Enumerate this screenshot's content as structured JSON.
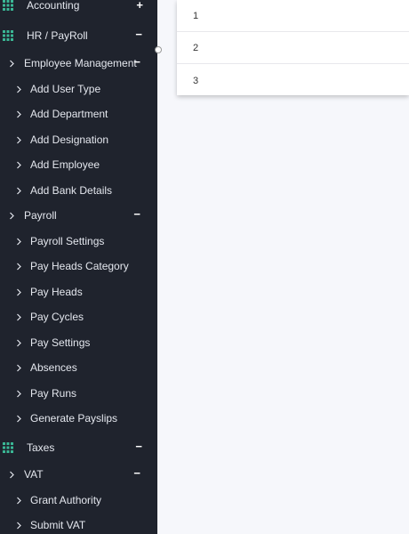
{
  "sidebar": {
    "sections": [
      {
        "label": "Accounting",
        "toggle": "+"
      },
      {
        "label": "HR / PayRoll",
        "toggle": "−"
      },
      {
        "label": "Taxes",
        "toggle": "−"
      }
    ],
    "submenus": [
      {
        "label": "Employee Management",
        "toggle": "−"
      },
      {
        "label": "Payroll",
        "toggle": "−"
      },
      {
        "label": "VAT",
        "toggle": "−"
      }
    ],
    "employee_items": [
      "Add User Type",
      "Add Department",
      "Add Designation",
      "Add Employee",
      "Add Bank Details"
    ],
    "payroll_items": [
      "Payroll Settings",
      "Pay Heads Category",
      "Pay Heads",
      "Pay Cycles",
      "Pay Settings",
      "Absences",
      "Pay Runs",
      "Generate Payslips"
    ],
    "vat_items": [
      "Grant Authority",
      "Submit VAT"
    ]
  },
  "table": {
    "rows": [
      "1",
      "2",
      "3"
    ]
  },
  "colors": {
    "sidebar_bg": "#1f232d",
    "accent_icon": "#3ab795",
    "content_bg": "#f6f7fb"
  }
}
